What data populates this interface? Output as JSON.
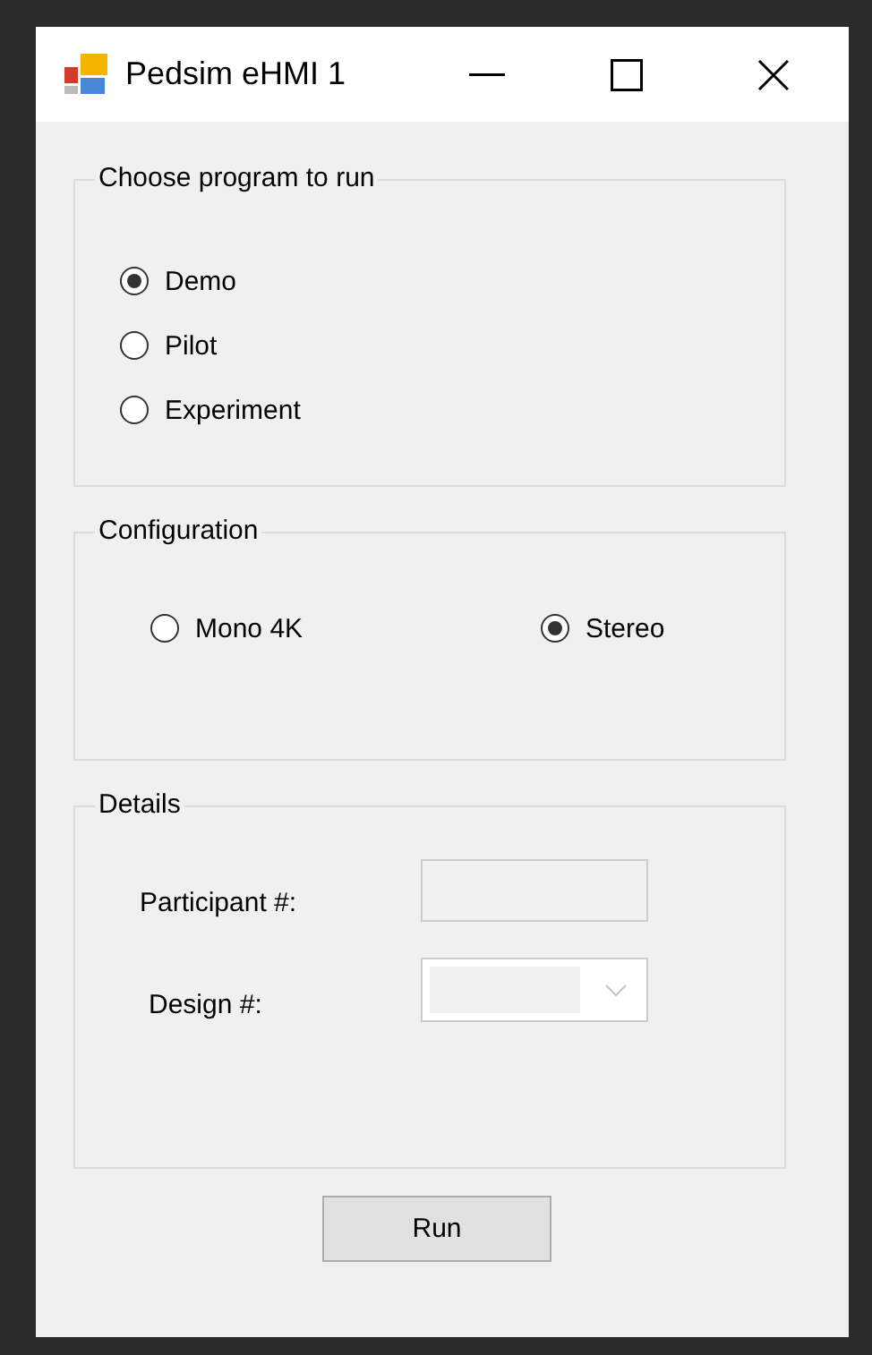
{
  "window": {
    "title": "Pedsim eHMI 1"
  },
  "program_group": {
    "title": "Choose program to run",
    "options": [
      {
        "label": "Demo",
        "selected": true
      },
      {
        "label": "Pilot",
        "selected": false
      },
      {
        "label": "Experiment",
        "selected": false
      }
    ]
  },
  "configuration_group": {
    "title": "Configuration",
    "options": [
      {
        "label": "Mono 4K",
        "selected": false
      },
      {
        "label": "Stereo",
        "selected": true
      }
    ]
  },
  "details_group": {
    "title": "Details",
    "fields": [
      {
        "kind": "text",
        "label": "Participant #:",
        "disabled": true
      },
      {
        "kind": "dropdown",
        "label": "Design #:",
        "disabled": true
      }
    ]
  },
  "buttons": [
    "Run"
  ]
}
